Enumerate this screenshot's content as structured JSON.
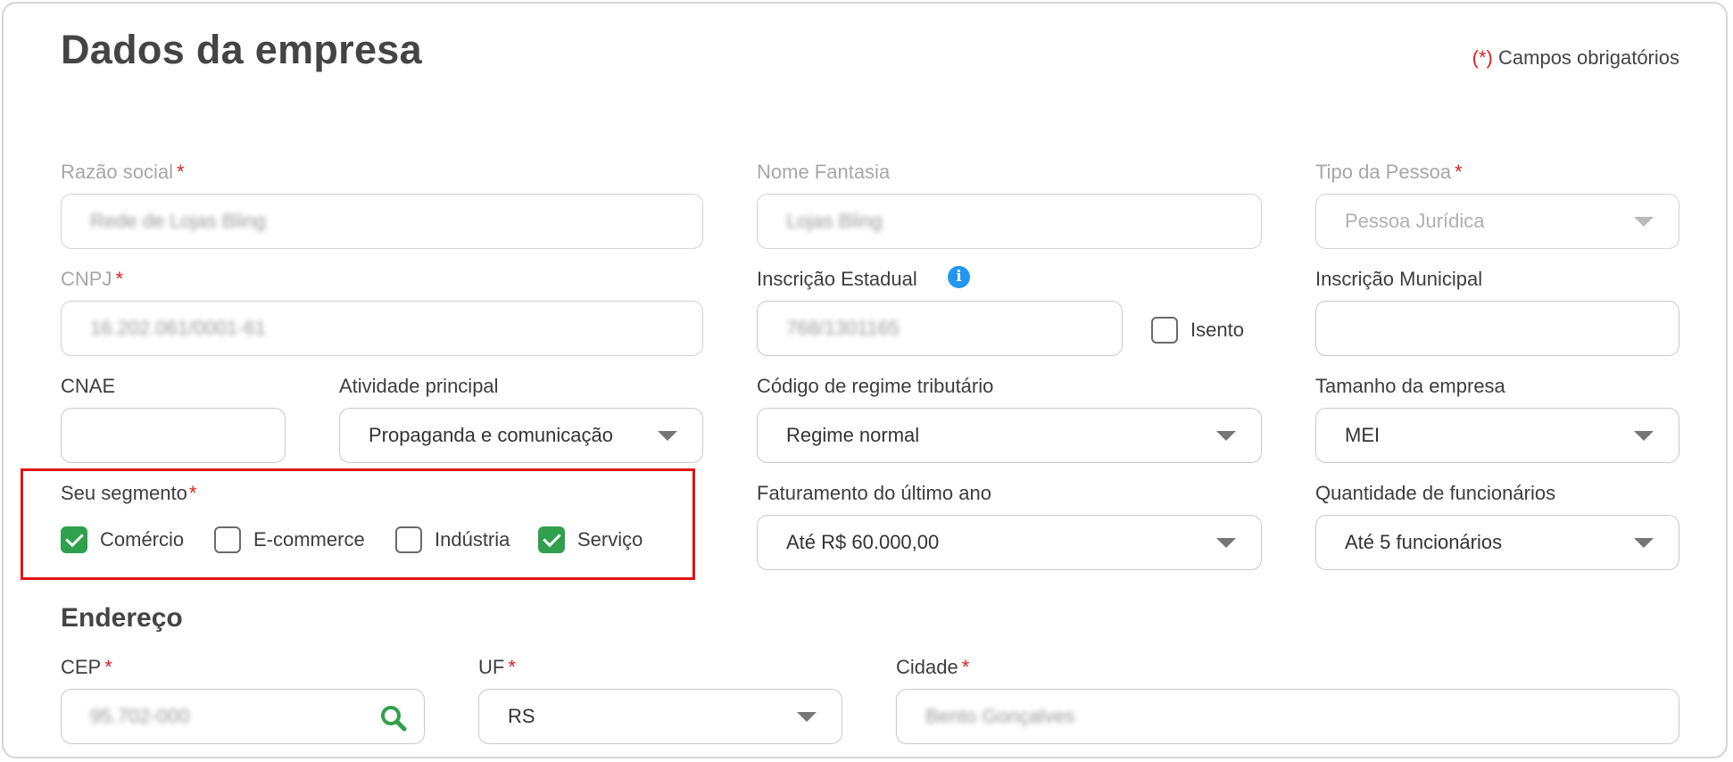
{
  "page": {
    "title": "Dados da empresa",
    "required_note_star": "(*)",
    "required_note_text": "Campos obrigatórios"
  },
  "form": {
    "razao_social": {
      "label": "Razão social",
      "required": "*",
      "value": "Rede de Lojas Bling"
    },
    "nome_fantasia": {
      "label": "Nome Fantasia",
      "value": "Lojas Bling"
    },
    "tipo_pessoa": {
      "label": "Tipo da Pessoa",
      "required": "*",
      "value": "Pessoa Jurídica"
    },
    "cnpj": {
      "label": "CNPJ",
      "required": "*",
      "value": "16.202.061/0001-61"
    },
    "inscricao_estadual": {
      "label": "Inscrição Estadual",
      "value": "768/1301165",
      "info_icon": "info-icon"
    },
    "isento": {
      "label": "Isento",
      "checked": false
    },
    "inscricao_municipal": {
      "label": "Inscrição Municipal",
      "value": ""
    },
    "cnae": {
      "label": "CNAE",
      "value": ""
    },
    "atividade_principal": {
      "label": "Atividade principal",
      "value": "Propaganda e comunicação"
    },
    "regime_tributario": {
      "label": "Código de regime tributário",
      "value": "Regime normal"
    },
    "tamanho_empresa": {
      "label": "Tamanho da empresa",
      "value": "MEI"
    },
    "segmento": {
      "label": "Seu segmento",
      "required": "*",
      "options": [
        {
          "label": "Comércio",
          "checked": true
        },
        {
          "label": "E-commerce",
          "checked": false
        },
        {
          "label": "Indústria",
          "checked": false
        },
        {
          "label": "Serviço",
          "checked": true
        }
      ]
    },
    "faturamento": {
      "label": "Faturamento do último ano",
      "value": "Até R$ 60.000,00"
    },
    "funcionarios": {
      "label": "Quantidade de funcionários",
      "value": "Até 5 funcionários"
    }
  },
  "endereco": {
    "title": "Endereço",
    "cep": {
      "label": "CEP",
      "required": "*",
      "value": "95.702-000",
      "icon": "search-icon"
    },
    "uf": {
      "label": "UF",
      "required": "*",
      "value": "RS"
    },
    "cidade": {
      "label": "Cidade",
      "required": "*",
      "value": "Bento Gonçalves"
    }
  },
  "colors": {
    "accent_green": "#2fa04c",
    "required_red": "#e02020",
    "highlight_red": "#e01515",
    "info_blue": "#2196f3"
  }
}
